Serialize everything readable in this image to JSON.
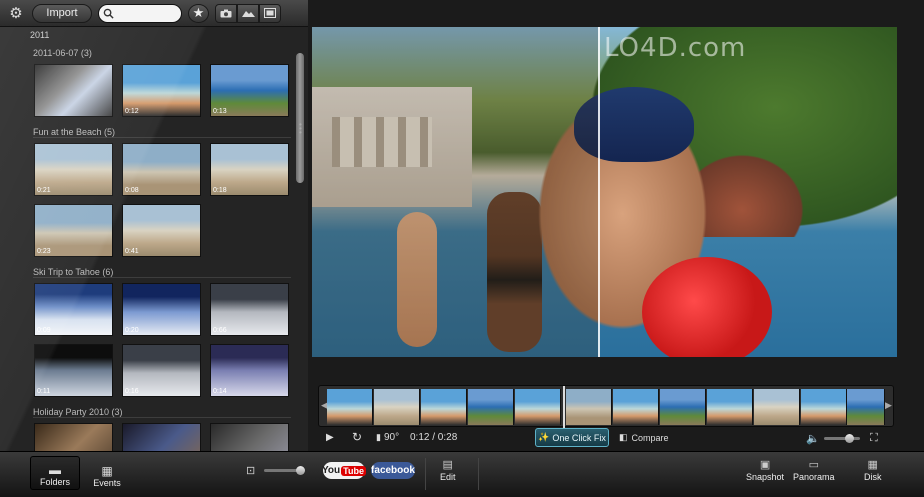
{
  "toolbar": {
    "import_label": "Import",
    "search_placeholder": "",
    "icons": [
      "gear-icon",
      "search-icon",
      "star-icon",
      "camera-icon",
      "panorama-icon",
      "filmstrip-icon"
    ]
  },
  "library": {
    "year": "2011",
    "groups": [
      {
        "label": "2011-06-07 (3)",
        "durations": [
          "",
          "0:12",
          "0:13"
        ]
      },
      {
        "label": "Fun at the Beach (5)",
        "durations": [
          "0:21",
          "0:08",
          "0:18",
          "0:23",
          "0:41"
        ]
      },
      {
        "label": "Ski Trip to Tahoe (6)",
        "durations": [
          "0:09",
          "0:20",
          "0:66",
          "0:11",
          "0:16",
          "0:14"
        ]
      },
      {
        "label": "Holiday Party 2010 (3)",
        "durations": [
          "",
          "",
          ""
        ]
      }
    ]
  },
  "bottom": {
    "folders_label": "Folders",
    "events_label": "Events",
    "youtube_label": "You",
    "youtube_tube": "Tube",
    "facebook_label": "facebook",
    "edit_label": "Edit",
    "snapshot_label": "Snapshot",
    "panorama_label": "Panorama",
    "disk_label": "Disk"
  },
  "viewer": {
    "watermark": "LO4D.com",
    "rotation": "90°",
    "time": "0:12 / 0:28",
    "one_click_fix_label": "One Click Fix",
    "compare_label": "Compare"
  },
  "colors": {
    "accent_fix": "#5eb2c8",
    "youtube_red": "#dd0000",
    "facebook_blue": "#3b5998"
  }
}
